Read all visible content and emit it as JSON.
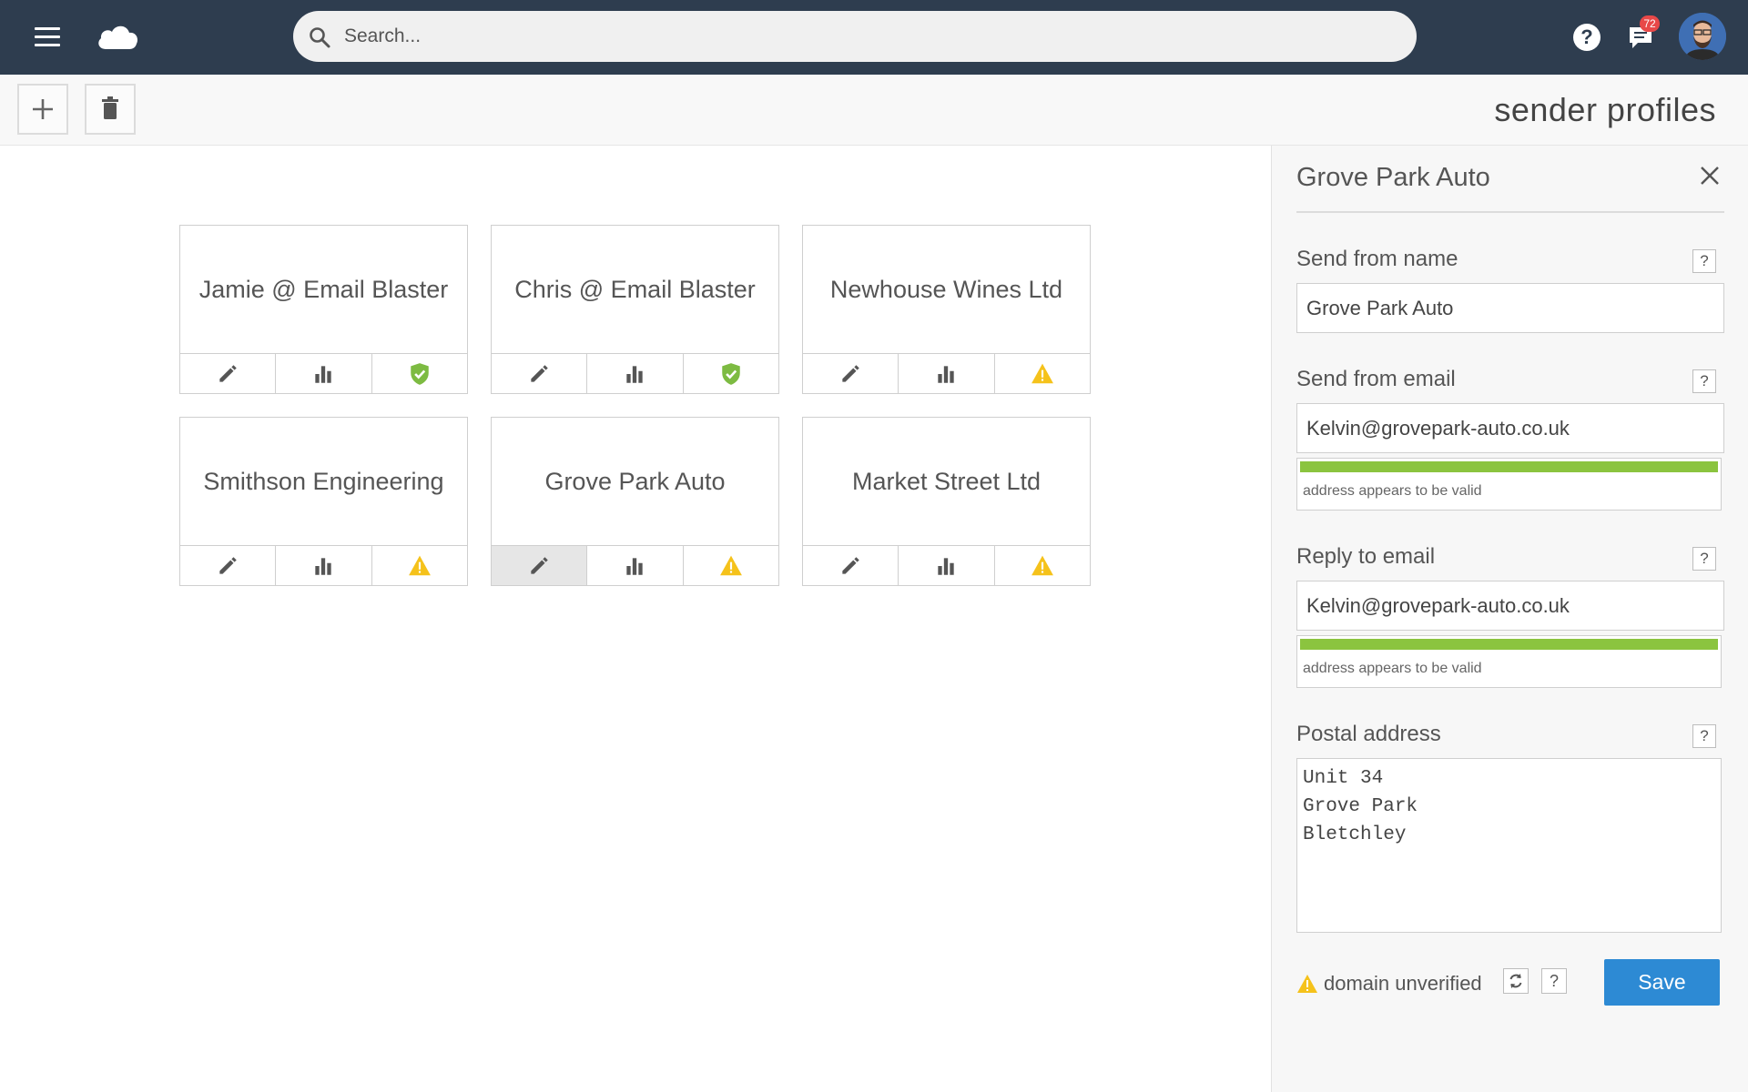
{
  "header": {
    "menu_icon": "hamburger-menu-icon",
    "logo_icon": "cloud-icon",
    "search_placeholder": "Search...",
    "help_icon": "help-icon",
    "notifications_count": "72",
    "avatar": "user-avatar"
  },
  "toolbar": {
    "add_icon": "plus-icon",
    "delete_icon": "trash-icon",
    "title": "sender profiles"
  },
  "profiles": [
    {
      "name": "Jamie @ Email Blaster",
      "status": "verified"
    },
    {
      "name": "Chris @ Email Blaster",
      "status": "verified"
    },
    {
      "name": "Newhouse Wines Ltd",
      "status": "warning"
    },
    {
      "name": "Smithson Engineering",
      "status": "warning"
    },
    {
      "name": "Grove Park Auto",
      "status": "warning",
      "editing": true
    },
    {
      "name": "Market Street Ltd",
      "status": "warning"
    }
  ],
  "colors": {
    "header_bg": "#2e3d4f",
    "verified": "#7dbb42",
    "warning": "#f5c21b",
    "save": "#2d8ad4",
    "valid_bar": "#8bc43f"
  },
  "panel": {
    "title": "Grove Park Auto",
    "send_from_name_label": "Send from name",
    "send_from_name_value": "Grove Park Auto",
    "send_from_email_label": "Send from email",
    "send_from_email_value": "Kelvin@grovepark-auto.co.uk",
    "send_from_email_status": "address appears to be valid",
    "reply_to_label": "Reply to email",
    "reply_to_value": "Kelvin@grovepark-auto.co.uk",
    "reply_to_status": "address appears to be valid",
    "postal_label": "Postal address",
    "postal_value": "Unit 34\nGrove Park\nBletchley",
    "help_mark": "?",
    "domain_status": "domain unverified",
    "save_label": "Save"
  }
}
